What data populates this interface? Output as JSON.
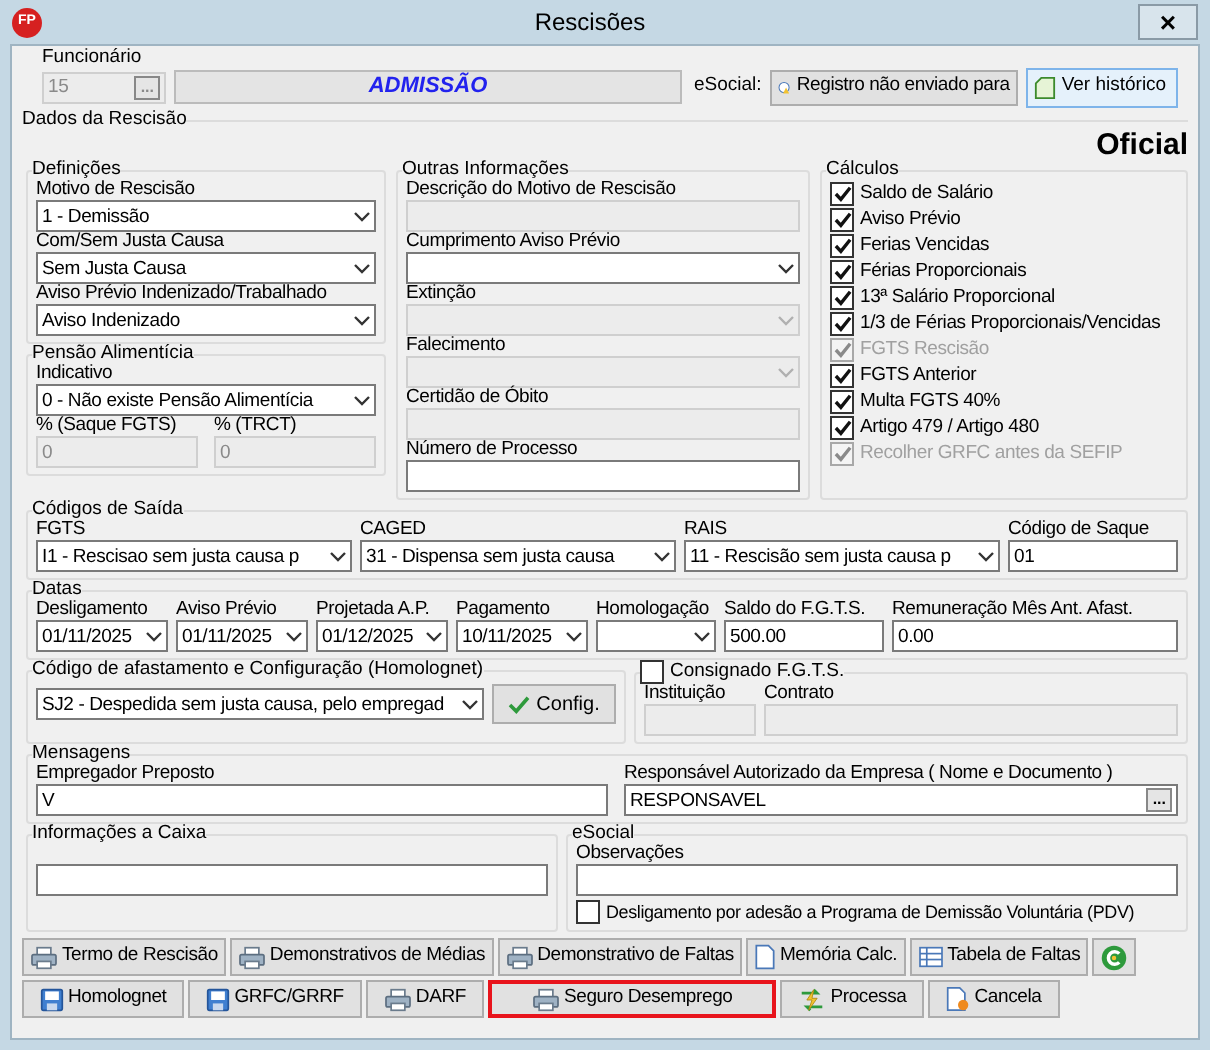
{
  "window": {
    "logo": "FP",
    "title": "Rescisões",
    "close": "×"
  },
  "header": {
    "funcionario": {
      "label": "Funcionário",
      "value": "15",
      "kind": "text",
      "disabled": true,
      "button": "..."
    },
    "admissao": "ADMISSÃO",
    "esocial_label": "eSocial:",
    "esocial_button": "Registro não enviado para",
    "history_button": "Ver histórico"
  },
  "dados": {
    "title": "Dados da Rescisão",
    "badge": "Oficial"
  },
  "definicoes": {
    "title": "Definições",
    "fields": [
      {
        "label": "Motivo de Rescisão",
        "value": "1 - Demissão",
        "kind": "select",
        "disabled": false
      },
      {
        "label": "Com/Sem Justa Causa",
        "value": "Sem Justa Causa",
        "kind": "select",
        "disabled": false
      },
      {
        "label": "Aviso Prévio Indenizado/Trabalhado",
        "value": "Aviso Indenizado",
        "kind": "select",
        "disabled": false
      }
    ]
  },
  "pensao": {
    "title": "Pensão Alimentícia",
    "fields": [
      {
        "label": "Indicativo",
        "value": "0 - Não existe Pensão Alimentícia",
        "kind": "select",
        "disabled": false
      }
    ],
    "percent": [
      {
        "label": "% (Saque FGTS)",
        "value": "0",
        "kind": "text",
        "disabled": true
      },
      {
        "label": "% (TRCT)",
        "value": "0",
        "kind": "text",
        "disabled": true
      }
    ]
  },
  "outras": {
    "title": "Outras Informações",
    "fields": [
      {
        "label": "Descrição do Motivo de Rescisão",
        "kind": "text",
        "disabled": true
      },
      {
        "label": "Cumprimento Aviso Prévio",
        "kind": "select",
        "disabled": false
      },
      {
        "label": "Extinção",
        "kind": "select",
        "disabled": true
      },
      {
        "label": "Falecimento",
        "kind": "select",
        "disabled": true
      },
      {
        "label": "Certidão de Óbito",
        "kind": "text",
        "disabled": true
      },
      {
        "label": "Número de Processo",
        "kind": "text",
        "disabled": false
      }
    ]
  },
  "calculos": {
    "title": "Cálculos",
    "items": [
      {
        "label": "Saldo de Salário",
        "checked": true,
        "disabled": false
      },
      {
        "label": "Aviso Prévio",
        "checked": true,
        "disabled": false
      },
      {
        "label": "Ferias Vencidas",
        "checked": true,
        "disabled": false
      },
      {
        "label": "Férias Proporcionais",
        "checked": true,
        "disabled": false
      },
      {
        "label": "13ª Salário Proporcional",
        "checked": true,
        "disabled": false
      },
      {
        "label": "1/3 de Férias Proporcionais/Vencidas",
        "checked": true,
        "disabled": false
      },
      {
        "label": "FGTS Rescisão",
        "checked": true,
        "disabled": true
      },
      {
        "label": "FGTS Anterior",
        "checked": true,
        "disabled": false
      },
      {
        "label": "Multa FGTS 40%",
        "checked": true,
        "disabled": false
      },
      {
        "label": "Artigo 479 / Artigo 480",
        "checked": true,
        "disabled": false
      },
      {
        "label": "Recolher GRFC antes da SEFIP",
        "checked": true,
        "disabled": true
      }
    ]
  },
  "codigos": {
    "title": "Códigos de Saída",
    "fields": [
      {
        "label": "FGTS",
        "value": "I1 - Rescisao sem justa causa p",
        "kind": "select",
        "disabled": false
      },
      {
        "label": "CAGED",
        "value": "31  - Dispensa sem justa causa",
        "kind": "select",
        "disabled": false
      },
      {
        "label": "RAIS",
        "value": "11 - Rescisão sem justa causa p",
        "kind": "select",
        "disabled": false
      },
      {
        "label": "Código de Saque",
        "value": "01",
        "kind": "text",
        "disabled": false
      }
    ]
  },
  "datas": {
    "title": "Datas",
    "fields": [
      {
        "label": "Desligamento",
        "value": "01/11/2025",
        "kind": "select",
        "disabled": false
      },
      {
        "label": "Aviso Prévio",
        "value": "01/11/2025",
        "kind": "select",
        "disabled": false
      },
      {
        "label": "Projetada A.P.",
        "value": "01/12/2025",
        "kind": "select",
        "disabled": false
      },
      {
        "label": "Pagamento",
        "value": "10/11/2025",
        "kind": "select",
        "disabled": false
      },
      {
        "label": "Homologação",
        "kind": "select",
        "disabled": false
      },
      {
        "label": "Saldo do F.G.T.S.",
        "value": "500.00",
        "kind": "text",
        "disabled": false
      },
      {
        "label": "Remuneração Mês Ant. Afast.",
        "value": "0.00",
        "kind": "text",
        "disabled": false
      }
    ]
  },
  "homolognet": {
    "title": "Código de afastamento e Configuração (Homolognet)",
    "field": {
      "value": "SJ2 - Despedida sem justa causa, pelo empregad",
      "kind": "select",
      "disabled": false
    },
    "button": "Config."
  },
  "consignado": {
    "label": "Consignado F.G.T.S.",
    "checked": false,
    "fields": [
      {
        "label": "Instituição",
        "kind": "text",
        "disabled": true
      },
      {
        "label": "Contrato",
        "kind": "text",
        "disabled": true
      }
    ]
  },
  "mensagens": {
    "title": "Mensagens",
    "fields": [
      {
        "label": "Empregador Preposto",
        "value": "V",
        "kind": "text",
        "disabled": false
      },
      {
        "label": "Responsável Autorizado da Empresa ( Nome e Documento )",
        "value": "RESPONSAVEL",
        "kind": "text",
        "disabled": false,
        "button": "..."
      }
    ]
  },
  "caixa": {
    "title": "Informações a Caixa",
    "field": {
      "kind": "text",
      "disabled": false
    }
  },
  "esocial": {
    "title": "eSocial",
    "fields": [
      {
        "label": "Observações",
        "kind": "text",
        "disabled": false
      }
    ],
    "pdv": {
      "label": "Desligamento por adesão a Programa de Demissão Voluntária (PDV)",
      "checked": false
    }
  },
  "buttons": [
    [
      {
        "label": "Termo de Rescisão",
        "kind": "printer",
        "highlighted": false
      },
      {
        "label": "Demonstrativos de Médias",
        "kind": "printer",
        "highlighted": false
      },
      {
        "label": "Demonstrativo de Faltas",
        "kind": "printer",
        "highlighted": false
      },
      {
        "label": "Memória Calc.",
        "kind": "document",
        "highlighted": false
      },
      {
        "label": "Tabela de Faltas",
        "kind": "table",
        "highlighted": false
      },
      {
        "kind": "refresh",
        "highlighted": false
      }
    ],
    [
      {
        "label": "Homolognet",
        "kind": "disk",
        "highlighted": false
      },
      {
        "label": "GRFC/GRRF",
        "kind": "disk",
        "highlighted": false
      },
      {
        "label": "DARF",
        "kind": "printer",
        "highlighted": false
      },
      {
        "label": "Seguro Desemprego",
        "kind": "printer",
        "highlighted": true
      },
      {
        "label": "Processa",
        "kind": "process",
        "highlighted": false
      },
      {
        "label": "Cancela",
        "kind": "cancel",
        "highlighted": false
      }
    ]
  ]
}
